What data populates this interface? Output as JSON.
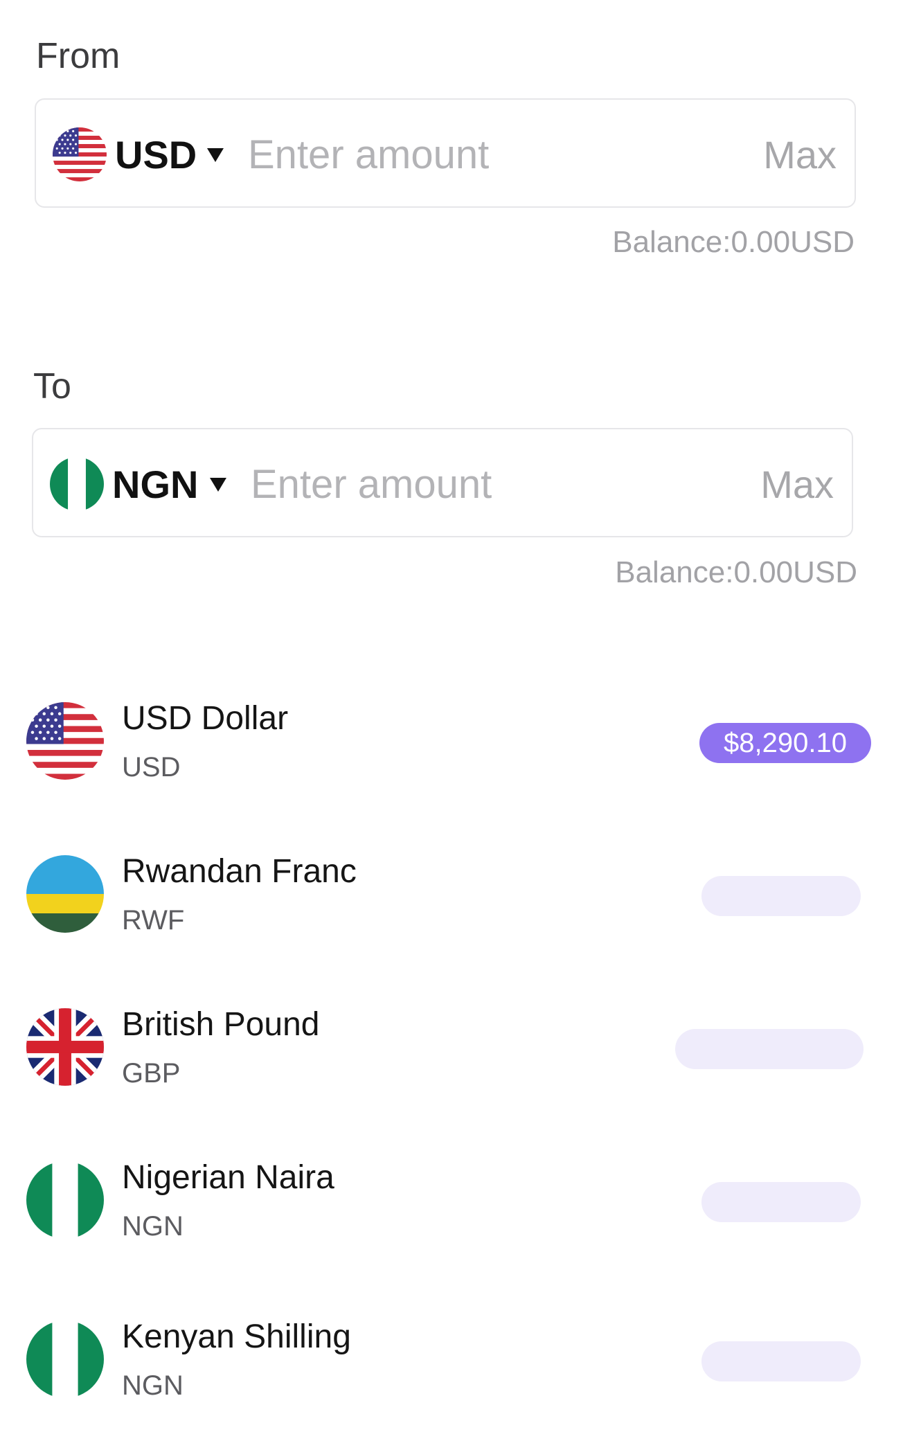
{
  "from": {
    "label": "From",
    "currency_code": "USD",
    "amount_placeholder": "Enter amount",
    "max_label": "Max",
    "balance": "Balance:0.00USD"
  },
  "to": {
    "label": "To",
    "currency_code": "NGN",
    "amount_placeholder": "Enter amount",
    "max_label": "Max",
    "balance": "Balance:0.00USD"
  },
  "currencies": [
    {
      "name": "USD Dollar",
      "code": "USD",
      "rate": "$8,290.10",
      "flag": "us-flag-icon"
    },
    {
      "name": "Rwandan Franc",
      "code": "RWF",
      "rate": "",
      "flag": "rw-flag-icon"
    },
    {
      "name": "British Pound",
      "code": "GBP",
      "rate": "",
      "flag": "gb-flag-icon"
    },
    {
      "name": "Nigerian Naira",
      "code": "NGN",
      "rate": "",
      "flag": "ng-flag-icon"
    },
    {
      "name": "Kenyan Shilling",
      "code": "NGN",
      "rate": "",
      "flag": "ng-flag-icon"
    }
  ],
  "colors": {
    "accent": "#8e72f0",
    "pill_placeholder": "#efecfb",
    "border": "#e6e6e9",
    "muted_text": "#a2a2a6"
  }
}
